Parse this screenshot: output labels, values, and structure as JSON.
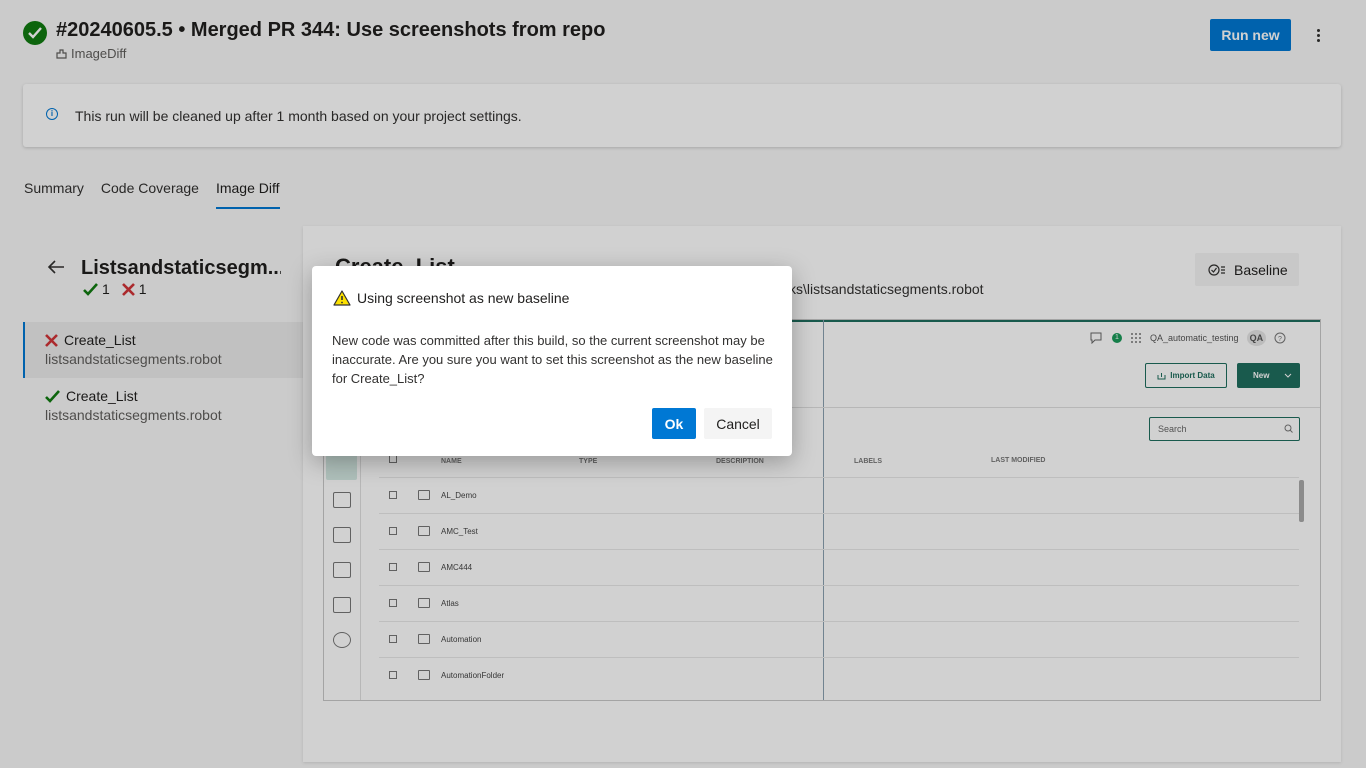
{
  "header": {
    "run_title": "#20240605.5 • Merged PR 344: Use screenshots from repo",
    "pipeline_name": "ImageDiff",
    "run_new_label": "Run new",
    "status_color": "#107c10",
    "accent_color": "#0078d4"
  },
  "banner": {
    "text": "This run will be cleaned up after 1 month based on your project settings.",
    "icon": "info-icon"
  },
  "tabs": [
    {
      "label": "Summary",
      "active": false
    },
    {
      "label": "Code Coverage",
      "active": false
    },
    {
      "label": "Image Diff",
      "active": true
    }
  ],
  "left_panel": {
    "title": "Listsandstaticsegm...",
    "pass_count": "1",
    "fail_count": "1",
    "items": [
      {
        "name": "Create_List",
        "file": "listsandstaticsegments.robot",
        "status": "failed",
        "selected": true
      },
      {
        "name": "Create_List",
        "file": "listsandstaticsegments.robot",
        "status": "passed",
        "selected": false
      }
    ]
  },
  "right_panel": {
    "title": "Create_List",
    "path": "ks\\listsandstaticsegments.robot",
    "baseline_label": "Baseline"
  },
  "screenshot": {
    "workspace": "QA_automatic_testing",
    "user_initials": "QA",
    "notification_count": "1",
    "import_label": "Import Data",
    "new_label": "New",
    "search_placeholder": "Search",
    "columns": [
      "NAME",
      "TYPE",
      "DESCRIPTION",
      "LABELS",
      "LAST MODIFIED"
    ],
    "rows": [
      "AL_Demo",
      "AMC_Test",
      "AMC444",
      "Atlas",
      "Automation",
      "AutomationFolder"
    ]
  },
  "dialog": {
    "title": "Using screenshot as new baseline",
    "message": "New code was committed after this build, so the current screenshot may be inaccurate. Are you sure you want to set this screenshot as the new baseline for Create_List?",
    "ok_label": "Ok",
    "cancel_label": "Cancel"
  }
}
